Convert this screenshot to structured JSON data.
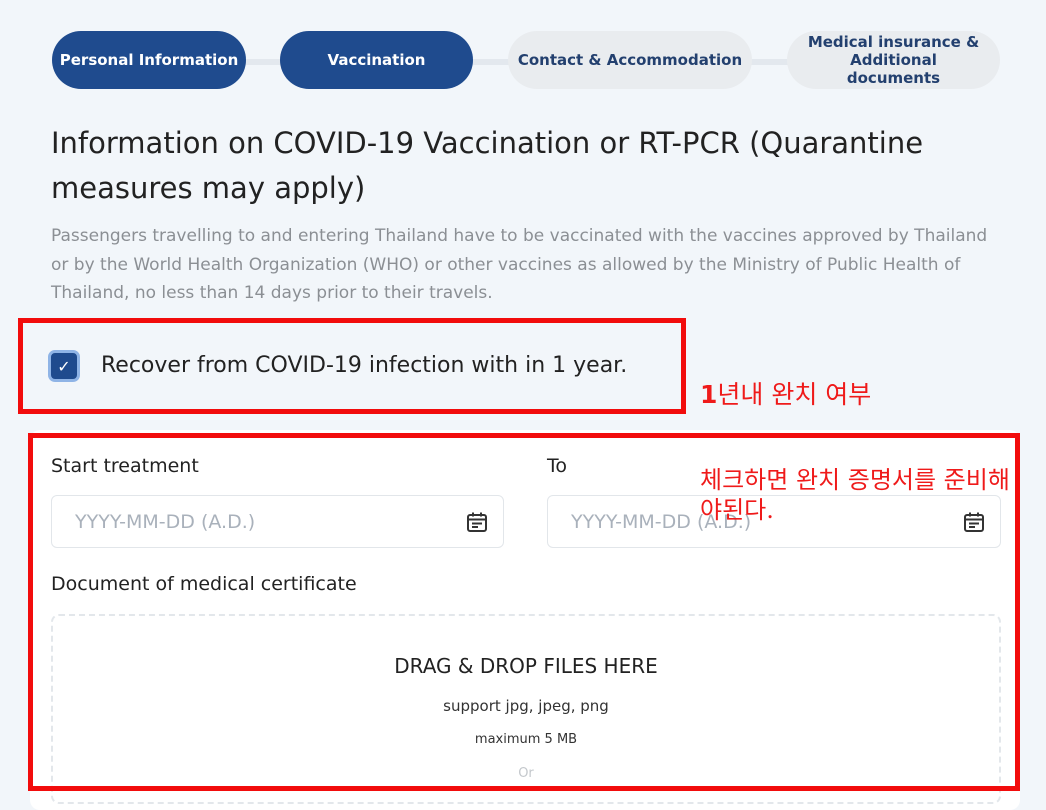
{
  "stepper": {
    "steps": [
      {
        "label": "Personal Information",
        "state": "active"
      },
      {
        "label": "Vaccination",
        "state": "active"
      },
      {
        "label": "Contact & Accommodation",
        "state": "inactive"
      },
      {
        "label": "Medical insurance & Additional documents",
        "state": "inactive"
      }
    ]
  },
  "section": {
    "title": "Information on COVID-19 Vaccination or RT-PCR (Quarantine measures may apply)",
    "description": "Passengers travelling to and entering Thailand have to be vaccinated with the vaccines approved by Thailand or by the World Health Organization (WHO) or other vaccines as allowed by the Ministry of Public Health of Thailand, no less than 14 days prior to their travels."
  },
  "recover_checkbox": {
    "checked": true,
    "label": "Recover from COVID-19 infection with in 1 year."
  },
  "annotations": {
    "note1_num": "1",
    "note1_rest": "년내 완치 여부",
    "note2": "체크하면 완치 증명서를 준비해야된다."
  },
  "treatment": {
    "start_label": "Start treatment",
    "start_placeholder": "YYYY-MM-DD (A.D.)",
    "to_label": "To",
    "to_placeholder": "YYYY-MM-DD (A.D.)",
    "calendar_icon": "calendar-icon"
  },
  "document": {
    "label": "Document of medical certificate",
    "drop_title": "DRAG & DROP FILES HERE",
    "support": "support jpg, jpeg, png",
    "max_size": "maximum 5 MB",
    "or": "Or"
  },
  "colors": {
    "primary": "#1f4b8e",
    "inactive_step": "#e9ecef",
    "annotation_red": "#f20c0c",
    "page_bg": "#f2f6fa"
  }
}
